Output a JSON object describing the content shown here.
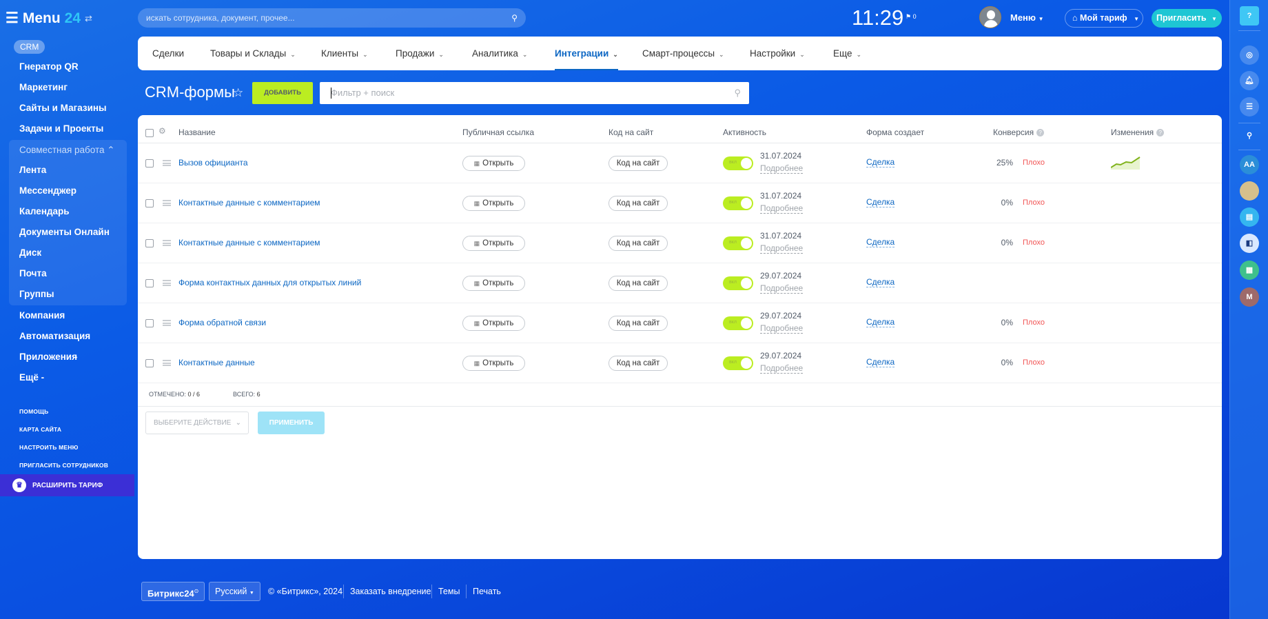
{
  "sidebar": {
    "title": "Menu",
    "title_num": "24",
    "active_pill": "CRM",
    "items": [
      "Гнератор QR",
      "Маркетинг",
      "Сайты и Магазины",
      "Задачи и Проекты"
    ],
    "group_label": "Совместная работа",
    "group_items": [
      "Лента",
      "Мессенджер",
      "Календарь",
      "Документы Онлайн",
      "Диск",
      "Почта",
      "Группы"
    ],
    "after_items": [
      "Компания",
      "Автоматизация",
      "Приложения",
      "Ещё -"
    ],
    "links": [
      "ПОМОЩЬ",
      "КАРТА САЙТА",
      "НАСТРОИТЬ МЕНЮ",
      "ПРИГЛАСИТЬ СОТРУДНИКОВ"
    ],
    "upgrade": "РАСШИРИТЬ ТАРИФ"
  },
  "topbar": {
    "search_placeholder": "искать сотрудника, документ, прочее...",
    "clock": "11:29",
    "flag_count": "0",
    "menu": "Меню",
    "tariff": "Мой тариф",
    "invite": "Пригласить"
  },
  "rightbar": {
    "initials_1": "AA",
    "initials_2": "M",
    "help": "?"
  },
  "nav": {
    "items": [
      "Сделки",
      "Товары и Склады",
      "Клиенты",
      "Продажи",
      "Аналитика",
      "Интеграции",
      "Смарт-процессы",
      "Настройки",
      "Еще"
    ],
    "active": "Интеграции"
  },
  "page": {
    "title": "CRM-формы",
    "add": "ДОБАВИТЬ",
    "filter_placeholder": "Фильтр + поиск"
  },
  "table": {
    "headers": {
      "name": "Название",
      "link": "Публичная ссылка",
      "code": "Код на сайт",
      "activity": "Активность",
      "creates": "Форма создает",
      "conversion": "Конверсия",
      "changes": "Изменения"
    },
    "rows": [
      {
        "name": "Вызов официанта",
        "open": "Открыть",
        "code": "Код на сайт",
        "toggle": "вкл",
        "date": "31.07.2024",
        "more": "Подробнее",
        "creates": "Сделка",
        "conversion": "25%",
        "rating": "Плохо",
        "has_spark": true
      },
      {
        "name": "Контактные данные с комментарием",
        "open": "Открыть",
        "code": "Код на сайт",
        "toggle": "вкл",
        "date": "31.07.2024",
        "more": "Подробнее",
        "creates": "Сделка",
        "conversion": "0%",
        "rating": "Плохо"
      },
      {
        "name": "Контактные данные с комментарием",
        "open": "Открыть",
        "code": "Код на сайт",
        "toggle": "вкл",
        "date": "31.07.2024",
        "more": "Подробнее",
        "creates": "Сделка",
        "conversion": "0%",
        "rating": "Плохо"
      },
      {
        "name": "Форма контактных данных для открытых линий",
        "open": "Открыть",
        "code": "Код на сайт",
        "toggle": "вкл",
        "date": "29.07.2024",
        "more": "Подробнее",
        "creates": "Сделка"
      },
      {
        "name": "Форма обратной связи",
        "open": "Открыть",
        "code": "Код на сайт",
        "toggle": "вкл",
        "date": "29.07.2024",
        "more": "Подробнее",
        "creates": "Сделка",
        "conversion": "0%",
        "rating": "Плохо"
      },
      {
        "name": "Контактные данные",
        "open": "Открыть",
        "code": "Код на сайт",
        "toggle": "вкл",
        "date": "29.07.2024",
        "more": "Подробнее",
        "creates": "Сделка",
        "conversion": "0%",
        "rating": "Плохо"
      }
    ],
    "selected_label": "ОТМЕЧЕНО:",
    "selected_value": "0 / 6",
    "total_label": "ВСЕГО:",
    "total_value": "6",
    "action_placeholder": "ВЫБЕРИТЕ ДЕЙСТВИЕ",
    "apply": "ПРИМЕНИТЬ"
  },
  "footer": {
    "brand": "Битрикс24",
    "language": "Русский",
    "copyright": "© «Битрикс», 2024",
    "links": [
      "Заказать внедрение",
      "Темы",
      "Печать"
    ]
  },
  "colors": {
    "accent": "#bbed21",
    "link": "#0b66c3",
    "bad": "#f15353",
    "invite": "#1ec6d4"
  }
}
